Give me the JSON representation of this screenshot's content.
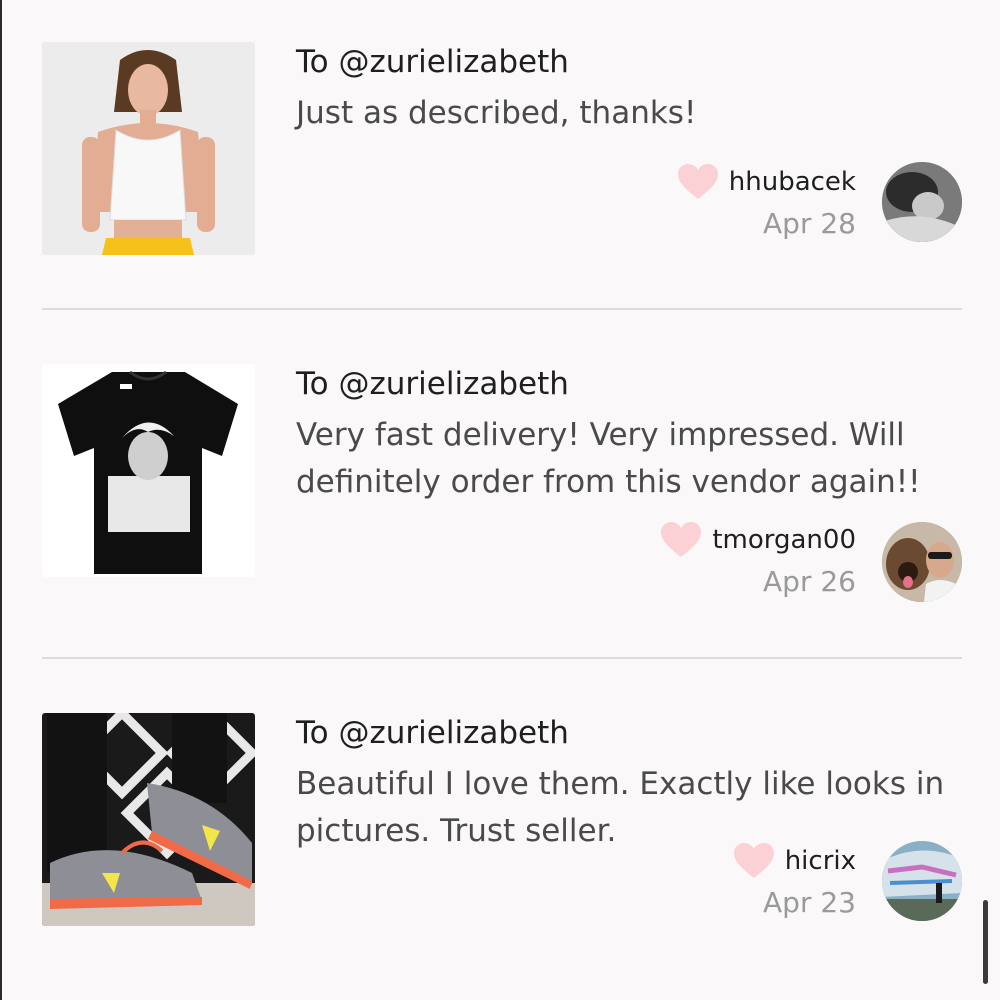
{
  "reviews": [
    {
      "recipient": "To @zurielizabeth",
      "message": "Just as described, thanks!",
      "username": "hhubacek",
      "date": "Apr 28",
      "product_icon": "white-crop-top-yellow-skirt"
    },
    {
      "recipient": "To @zurielizabeth",
      "message": "Very fast delivery! Very impressed. Will definitely order from this vendor again!!",
      "username": "tmorgan00",
      "date": "Apr 26",
      "product_icon": "black-graphic-tshirt"
    },
    {
      "recipient": "To @zurielizabeth",
      "message": "Beautiful I love them. Exactly like looks in pictures. Trust seller.",
      "username": "hicrix",
      "date": "Apr 23",
      "product_icon": "floral-sneakers"
    }
  ],
  "colors": {
    "heart": "#fbd1d6",
    "background": "#faf8f9",
    "divider": "#dedbdc"
  }
}
